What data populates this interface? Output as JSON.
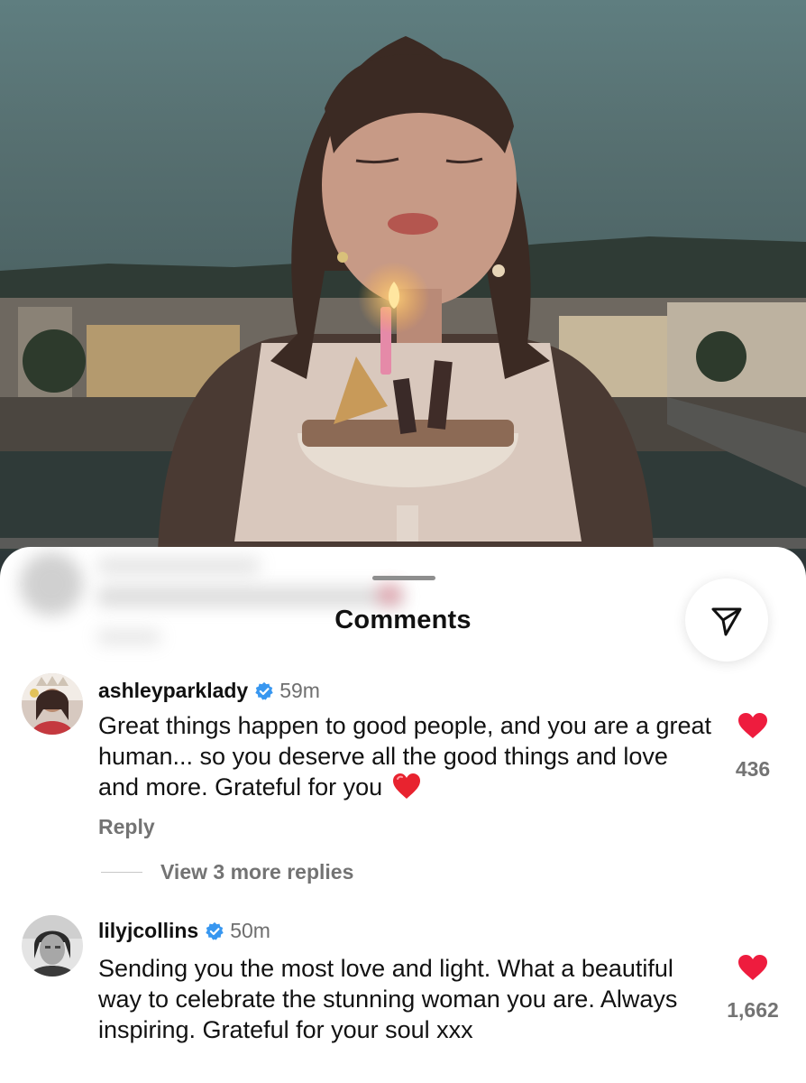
{
  "sheet": {
    "title": "Comments",
    "share_icon": "paper-plane-icon"
  },
  "comments": [
    {
      "username": "ashleyparklady",
      "verified": true,
      "time": "59m",
      "text": "Great things happen to good people, and you are a great human... so you deserve all the good things and love and more. Grateful for you",
      "emoji": "red-heart",
      "reply_label": "Reply",
      "view_replies_label": "View 3 more replies",
      "like_count": "436"
    },
    {
      "username": "lilyjcollins",
      "verified": true,
      "time": "50m",
      "text": "Sending you the most love and light. What a beautiful way to celebrate the stunning woman you are. Always inspiring. Grateful for your soul xxx",
      "like_count": "1,662"
    }
  ],
  "colors": {
    "like_heart": "#ee1c3e",
    "verified_badge": "#3897f0",
    "muted_text": "#737373"
  }
}
